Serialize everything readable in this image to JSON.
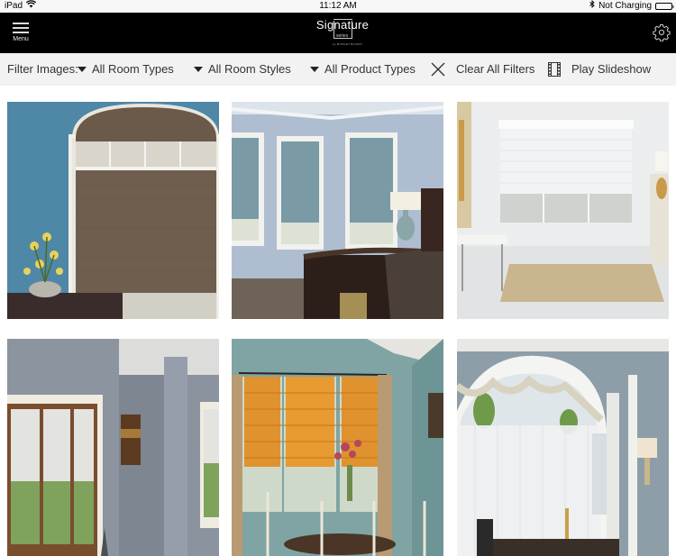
{
  "status_bar": {
    "device": "iPad",
    "time": "11:12 AM",
    "charging_status": "Not Charging",
    "icons": [
      "wifi-icon",
      "bluetooth-icon",
      "battery-icon"
    ]
  },
  "header": {
    "menu_label": "Menu",
    "logo": {
      "word": "Signature",
      "sub": "series",
      "by": "by BUDGET BLINDS"
    },
    "settings_icon": "gear-icon"
  },
  "filter_bar": {
    "label": "Filter Images:",
    "dropdowns": [
      {
        "selected": "All Room Types"
      },
      {
        "selected": "All Room Styles"
      },
      {
        "selected": "All Product Types"
      }
    ],
    "clear_label": "Clear All Filters",
    "slideshow_label": "Play Slideshow"
  },
  "gallery": {
    "images": [
      {
        "description": "Blue room with arched window and brown top-down cellular shade, yellow orchids"
      },
      {
        "description": "Light blue bedroom with light blue cellular shades, dark wood bed and lamp"
      },
      {
        "description": "White room with white cellular shade, bench and beige rug"
      },
      {
        "description": "Gray room with wood-framed doors and white cellular shades, abstract painting"
      },
      {
        "description": "Teal dining room with orange roman shades and floral curtains"
      },
      {
        "description": "Dining room with arched window, swag valance and sheer white shades"
      }
    ]
  }
}
